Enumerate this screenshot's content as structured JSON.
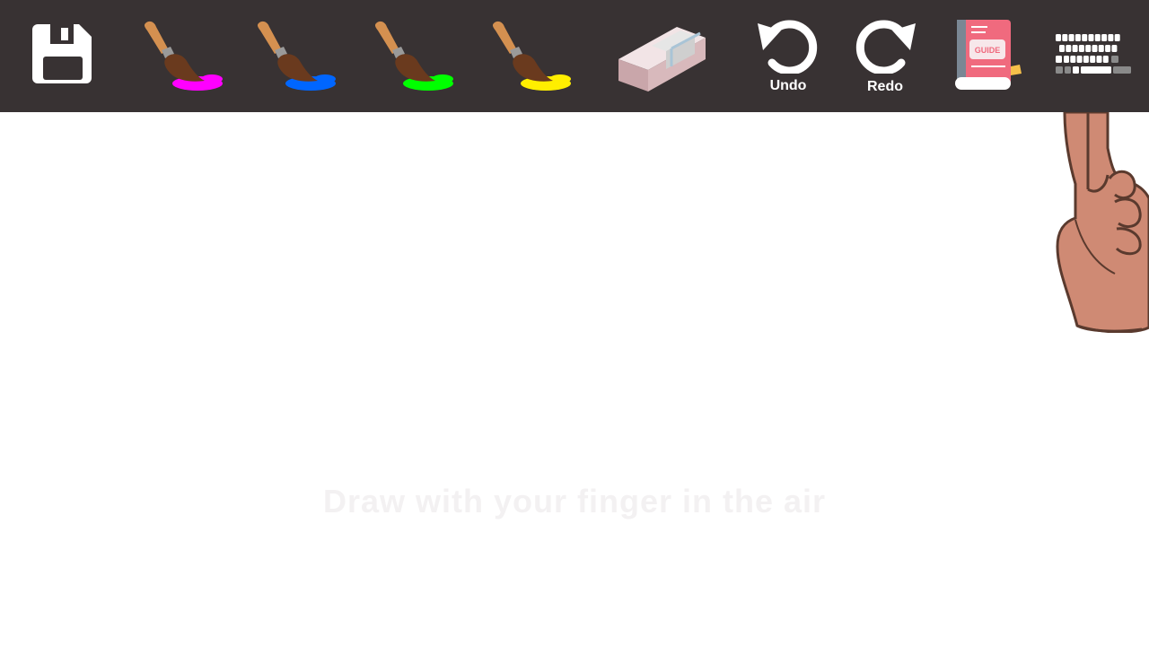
{
  "toolbar": {
    "background": "#383233",
    "tools": [
      {
        "name": "save",
        "icon": "floppy-disk-icon"
      },
      {
        "name": "brush",
        "color": "#ff00ff",
        "icon": "paintbrush-icon"
      },
      {
        "name": "brush",
        "color": "#0066ff",
        "icon": "paintbrush-icon"
      },
      {
        "name": "brush",
        "color": "#00ff00",
        "icon": "paintbrush-icon"
      },
      {
        "name": "brush",
        "color": "#ffee00",
        "icon": "paintbrush-icon"
      },
      {
        "name": "eraser",
        "icon": "eraser-icon"
      },
      {
        "name": "undo",
        "icon": "undo-arrow-icon"
      },
      {
        "name": "redo",
        "icon": "redo-arrow-icon"
      },
      {
        "name": "guide",
        "icon": "guide-book-icon"
      },
      {
        "name": "keyboard",
        "icon": "keyboard-icon"
      }
    ],
    "undo_label": "Undo",
    "redo_label": "Redo",
    "guide_label": "GUIDE"
  },
  "canvas": {
    "watermark": "Draw with your finger in the air",
    "cursor_icon": "pointing-hand-icon"
  }
}
